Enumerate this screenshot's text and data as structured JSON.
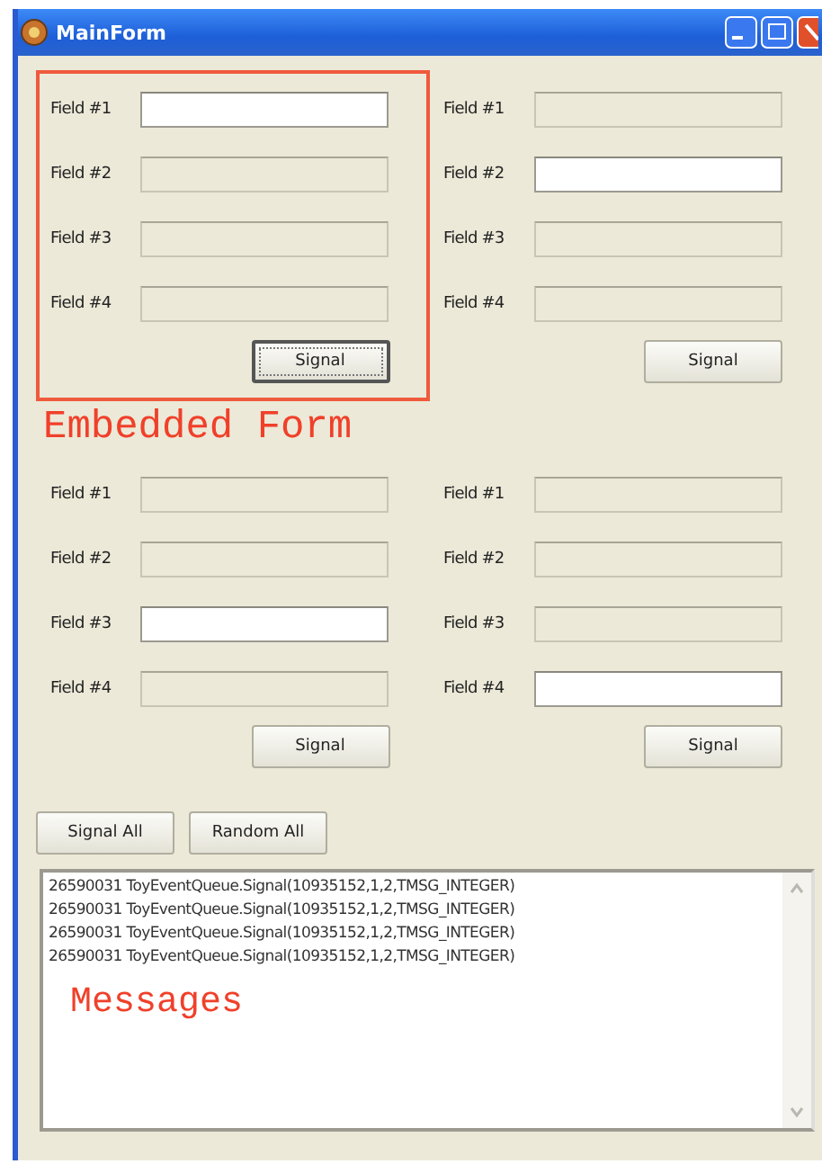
{
  "window": {
    "title": "MainForm"
  },
  "panels": [
    {
      "annotation": "Embedded Form",
      "fields": [
        {
          "label": "Field #1",
          "disabled": false
        },
        {
          "label": "Field #2",
          "disabled": true
        },
        {
          "label": "Field #3",
          "disabled": true
        },
        {
          "label": "Field #4",
          "disabled": true
        }
      ],
      "button": {
        "label": "Signal",
        "focused": true
      }
    },
    {
      "fields": [
        {
          "label": "Field #1",
          "disabled": true
        },
        {
          "label": "Field #2",
          "disabled": false
        },
        {
          "label": "Field #3",
          "disabled": true
        },
        {
          "label": "Field #4",
          "disabled": true
        }
      ],
      "button": {
        "label": "Signal",
        "focused": false
      }
    },
    {
      "fields": [
        {
          "label": "Field #1",
          "disabled": true
        },
        {
          "label": "Field #2",
          "disabled": true
        },
        {
          "label": "Field #3",
          "disabled": false
        },
        {
          "label": "Field #4",
          "disabled": true
        }
      ],
      "button": {
        "label": "Signal",
        "focused": false
      }
    },
    {
      "fields": [
        {
          "label": "Field #1",
          "disabled": true
        },
        {
          "label": "Field #2",
          "disabled": true
        },
        {
          "label": "Field #3",
          "disabled": true
        },
        {
          "label": "Field #4",
          "disabled": false
        }
      ],
      "button": {
        "label": "Signal",
        "focused": false
      }
    }
  ],
  "actions": [
    "Signal All",
    "Random All"
  ],
  "messages": {
    "lines": [
      "26590031 ToyEventQueue.Signal(10935152,1,2,TMSG_INTEGER)",
      "26590031 ToyEventQueue.Signal(10935152,1,2,TMSG_INTEGER)",
      "26590031 ToyEventQueue.Signal(10935152,1,2,TMSG_INTEGER)",
      "26590031 ToyEventQueue.Signal(10935152,1,2,TMSG_INTEGER)"
    ],
    "annotation": "Messages"
  }
}
